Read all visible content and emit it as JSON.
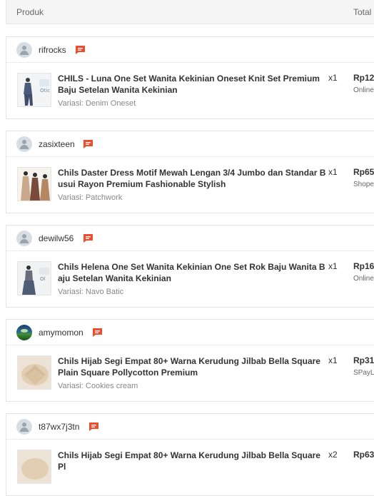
{
  "header": {
    "produk": "Produk",
    "total": "Total"
  },
  "orders": [
    {
      "seller": "rifrocks",
      "avatar": "default-user-icon",
      "title": "CHILS - Luna One Set Wanita Kekinian Oneset Knit Set Premium Baju Setelan Wanita Kekinian",
      "variasi": "Variasi: Denim Oneset",
      "qty": "x1",
      "price": "Rp12",
      "payment": "Online"
    },
    {
      "seller": "zasixteen",
      "avatar": "default-user-icon",
      "title": "Chils Daster Dress Motif Mewah Lengan 3/4 Jumbo dan Standar Busui Rayon Premium Fashionable Stylish",
      "variasi": "Variasi: Patchwork",
      "qty": "x1",
      "price": "Rp65",
      "payment": "Shope"
    },
    {
      "seller": "dewilw56",
      "avatar": "default-user-icon",
      "title": "Chils Helena One Set Wanita Kekinian One Set Rok Baju Wanita Baju Setelan Wanita Kekinian",
      "variasi": "Variasi: Navo Batic",
      "qty": "x1",
      "price": "Rp16",
      "payment": "Online"
    },
    {
      "seller": "amymomon",
      "avatar": "photo-avatar",
      "title": "Chils Hijab Segi Empat 80+ Warna Kerudung Jilbab Bella Square Plain Square Pollycotton Premium",
      "variasi": "Variasi: Cookies cream",
      "qty": "x1",
      "price": "Rp31",
      "payment": "SPayL"
    },
    {
      "seller": "t87wx7j3tn",
      "avatar": "default-user-icon",
      "title": "Chils Hijab Segi Empat 80+ Warna Kerudung Jilbab Bella Square Pl",
      "variasi": "",
      "qty": "x2",
      "price": "Rp63",
      "payment": ""
    }
  ],
  "colors": {
    "chat_icon": "#ee4d2d",
    "header_bg": "#f5f5f5",
    "border": "#e5e5e5"
  }
}
